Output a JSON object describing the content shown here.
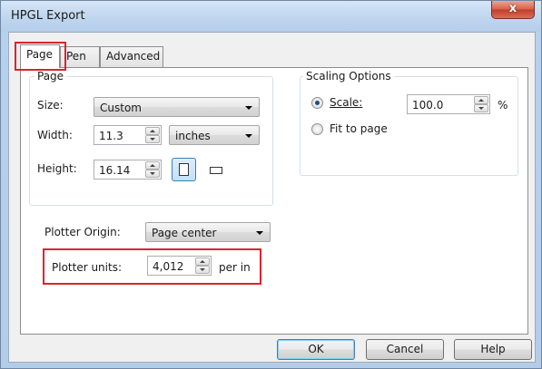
{
  "window": {
    "title": "HPGL Export",
    "close_label": "x"
  },
  "tabs": [
    {
      "label": "Page",
      "active": true
    },
    {
      "label": "Pen",
      "active": false
    },
    {
      "label": "Advanced",
      "active": false
    }
  ],
  "page_group": {
    "legend": "Page",
    "size_label": "Size:",
    "size_value": "Custom",
    "width_label": "Width:",
    "width_value": "11.3",
    "unit_value": "inches",
    "height_label": "Height:",
    "height_value": "16.14"
  },
  "scaling_group": {
    "legend": "Scaling Options",
    "scale_label": "Scale:",
    "scale_value": "100.0",
    "scale_unit": "%",
    "fit_label": "Fit to page",
    "selected": "scale"
  },
  "plotter_origin": {
    "label": "Plotter Origin:",
    "value": "Page center"
  },
  "plotter_units": {
    "label": "Plotter units:",
    "value": "4,012",
    "suffix": "per in"
  },
  "buttons": {
    "ok": "OK",
    "cancel": "Cancel",
    "help": "Help"
  },
  "highlight_color": "#d9252f"
}
